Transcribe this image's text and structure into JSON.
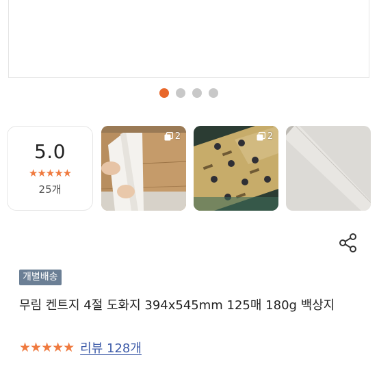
{
  "carousel": {
    "total_dots": 4,
    "active_index": 0,
    "active_color": "#e8672a"
  },
  "rating": {
    "score": "5.0",
    "stars": "★★★★★",
    "count": "25개",
    "star_color": "#ef7a3f"
  },
  "photos": [
    {
      "multi_count": "2"
    },
    {
      "multi_count": "2"
    },
    {
      "multi_count": ""
    }
  ],
  "share_icon": "share-icon",
  "product": {
    "badge": "개별배송",
    "title": "무림 켄트지 4절 도화지 394x545mm 125매 180g 백상지",
    "stars": "★★★★★",
    "review_link": "리뷰 128개"
  }
}
